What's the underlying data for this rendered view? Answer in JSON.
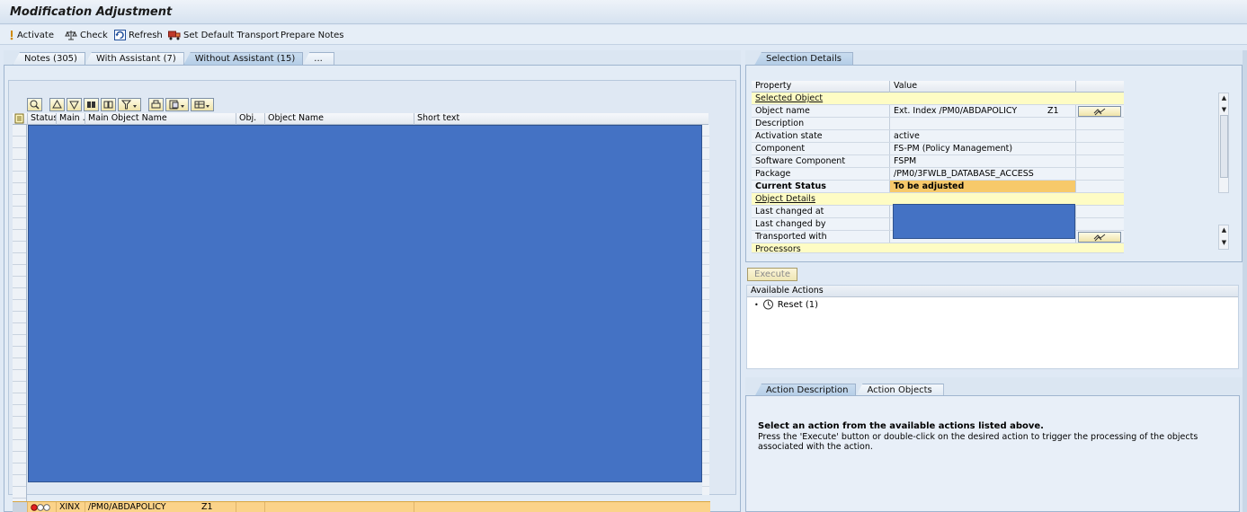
{
  "window": {
    "title": "Modification Adjustment"
  },
  "toolbar": {
    "activate": "Activate",
    "check": "Check",
    "refresh": "Refresh",
    "set_default_transport": "Set Default Transport",
    "prepare_notes": "Prepare Notes"
  },
  "left_tabs": [
    "Notes (305)",
    "With Assistant (7)",
    "Without Assistant (15)",
    "..."
  ],
  "left_tabs_active": "Without Assistant (15)",
  "grid": {
    "columns": [
      "Status",
      "Main ...",
      "Main Object Name",
      "Obj.",
      "Object Name",
      "Short text"
    ],
    "selected_row": {
      "main": "XINX",
      "main_object_name": "/PM0/ABDAPOLICY",
      "obj": "Z1"
    }
  },
  "selection": {
    "tab": "Selection Details",
    "header": {
      "property": "Property",
      "value": "Value"
    },
    "group_selected_object": "Selected Object",
    "object_name": {
      "label": "Object name",
      "value": "Ext. Index /PM0/ABDAPOLICY",
      "suffix": "Z1"
    },
    "description": {
      "label": "Description",
      "value": ""
    },
    "activation_state": {
      "label": "Activation state",
      "value": "active"
    },
    "component": {
      "label": "Component",
      "value": "FS-PM (Policy Management)"
    },
    "software_component": {
      "label": "Software Component",
      "value": "FSPM"
    },
    "package": {
      "label": "Package",
      "value": "/PM0/3FWLB_DATABASE_ACCESS"
    },
    "current_status": {
      "label": "Current Status",
      "value": "To be adjusted"
    },
    "group_object_details": "Object Details",
    "last_changed_at": {
      "label": "Last changed at"
    },
    "last_changed_by": {
      "label": "Last changed by"
    },
    "transported_with": {
      "label": "Transported with"
    },
    "processors": "Processors"
  },
  "execute": {
    "label": "Execute"
  },
  "actions": {
    "header": "Available Actions",
    "items": [
      {
        "label": "Reset (1)"
      }
    ]
  },
  "bottom_tabs": [
    "Action Description",
    "Action Objects"
  ],
  "description": {
    "title": "Select an action from the available actions listed above.",
    "text": "Press the 'Execute' button or double-click on the desired action to trigger the processing of the objects associated with the action."
  },
  "colors": {
    "redacted": "#4472c4",
    "selected_row": "#fbd38a",
    "status_highlight": "#f7c96a",
    "group_row": "#fefcc4"
  }
}
